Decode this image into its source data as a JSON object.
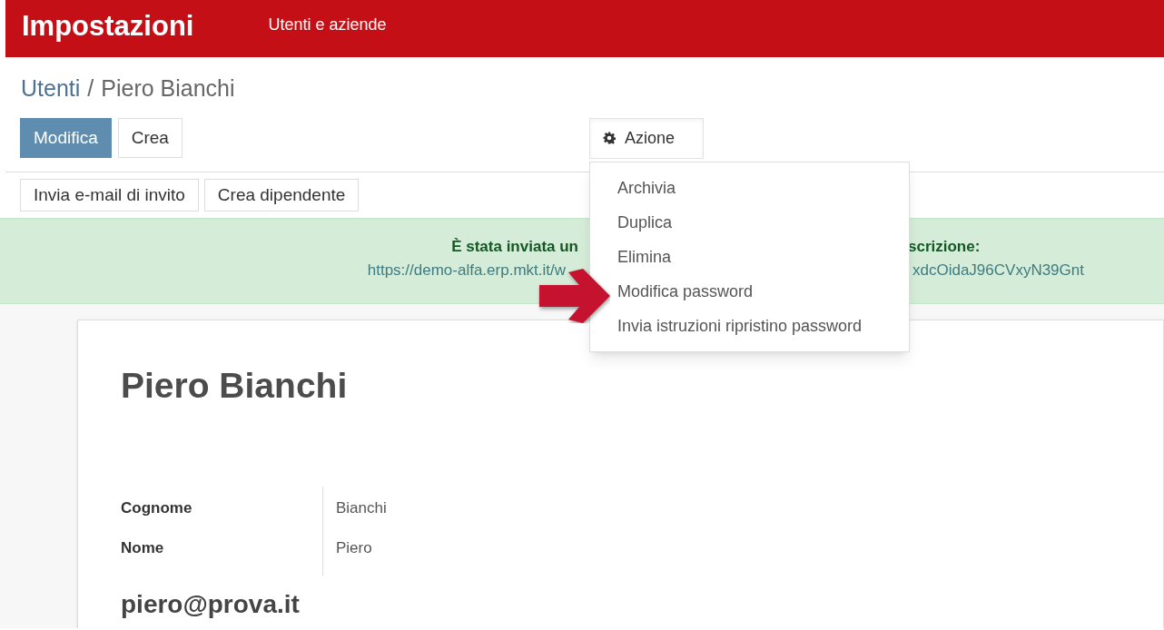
{
  "header": {
    "title": "Impostazioni",
    "menu": [
      {
        "label": "Utenti e aziende"
      }
    ]
  },
  "breadcrumb": {
    "parent": "Utenti",
    "separator": "/",
    "current": "Piero Bianchi"
  },
  "control_buttons": [
    {
      "label": "Modifica",
      "kind": "primary"
    },
    {
      "label": "Crea",
      "kind": "secondary"
    }
  ],
  "action_menu": {
    "label": "Azione",
    "expanded": true,
    "items": [
      "Archivia",
      "Duplica",
      "Elimina",
      "Modifica password",
      "Invia istruzioni ripristino password"
    ]
  },
  "status_buttons": [
    "Invia e-mail di invito",
    "Crea dipendente"
  ],
  "alert": {
    "title_parts": [
      "È stata inviata un",
      "scrizione:"
    ],
    "link_parts": [
      "https://demo-alfa.erp.mkt.it/w",
      "xdcOidaJ96CVxyN39Gnt"
    ]
  },
  "form": {
    "name": "Piero Bianchi",
    "fields": [
      {
        "label": "Cognome",
        "value": "Bianchi"
      },
      {
        "label": "Nome",
        "value": "Piero"
      }
    ],
    "email": "piero@prova.it"
  }
}
